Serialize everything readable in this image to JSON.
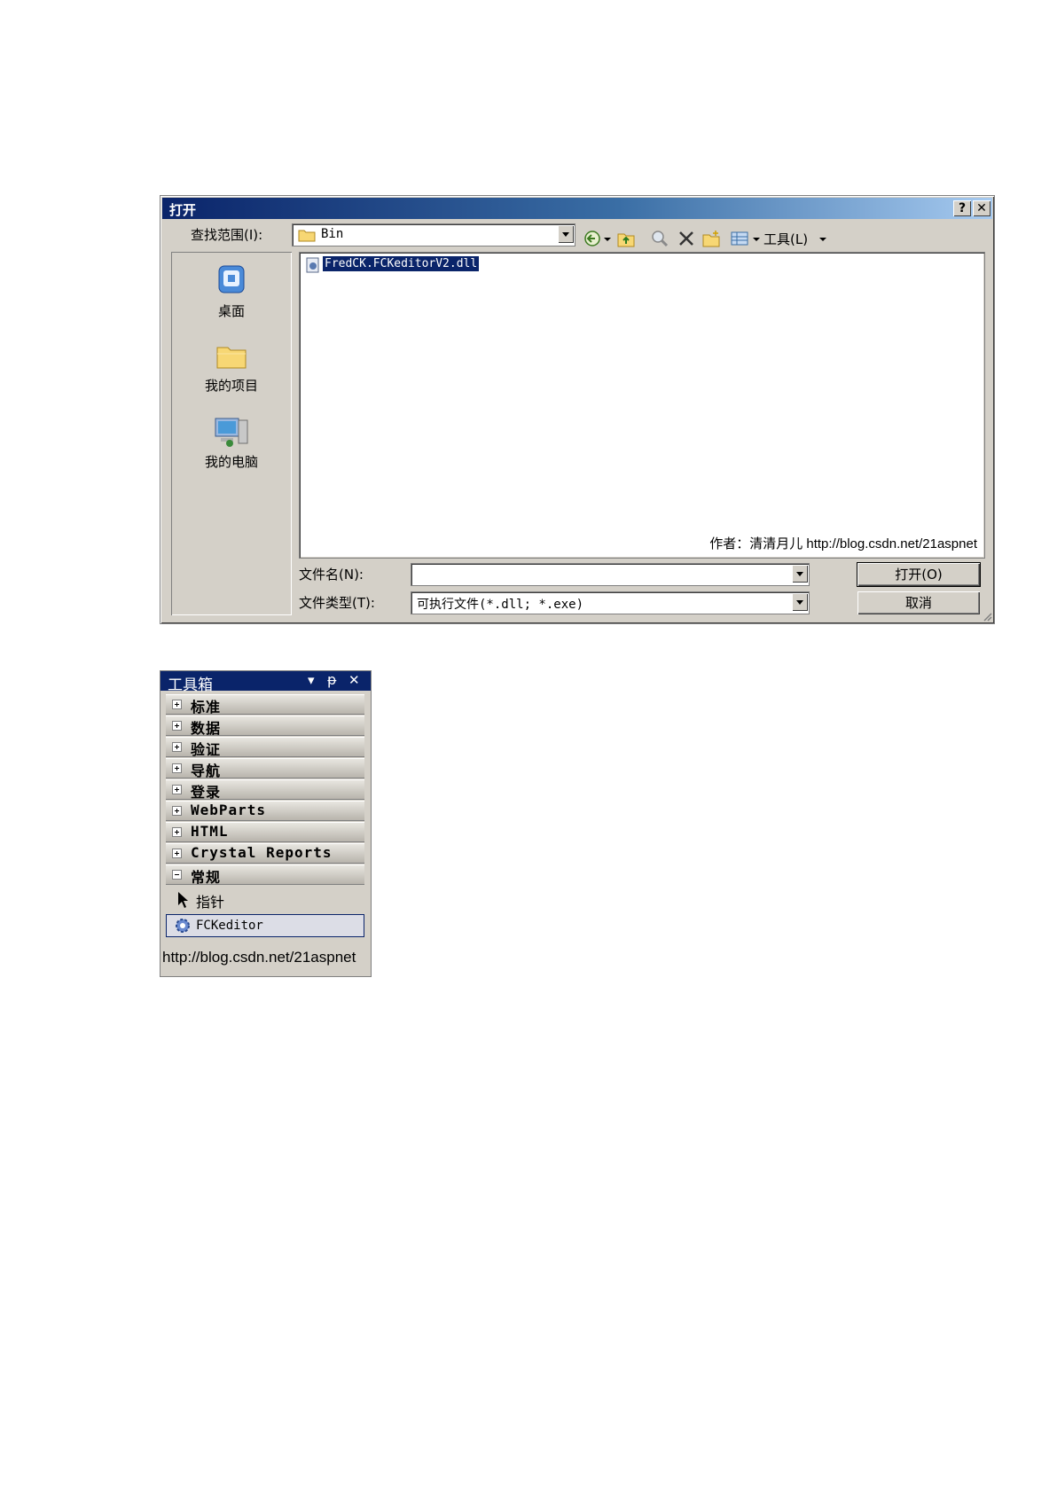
{
  "dialog": {
    "title": "打开",
    "help_btn": "?",
    "close_btn": "✕",
    "look_in_label": "查找范围(I):",
    "look_in_value": "Bin",
    "tools_label": "工具(L)",
    "places": [
      {
        "label": "桌面",
        "icon": "desktop-icon"
      },
      {
        "label": "我的项目",
        "icon": "folder-icon"
      },
      {
        "label": "我的电脑",
        "icon": "computer-icon"
      }
    ],
    "files": [
      {
        "name": "FredCK.FCKeditorV2.dll",
        "selected": true
      }
    ],
    "watermark": "作者：清清月儿 http://blog.csdn.net/21aspnet",
    "filename_label": "文件名(N):",
    "filename_value": "",
    "filetype_label": "文件类型(T):",
    "filetype_value": "可执行文件(*.dll; *.exe)",
    "open_button": "打开(O)",
    "cancel_button": "取消"
  },
  "toolbox": {
    "title": "工具箱",
    "controls": {
      "dropdown": "▾",
      "pin": "ᵽ",
      "close": "✕"
    },
    "categories": [
      {
        "label": "标准",
        "expanded": false
      },
      {
        "label": "数据",
        "expanded": false
      },
      {
        "label": "验证",
        "expanded": false
      },
      {
        "label": "导航",
        "expanded": false
      },
      {
        "label": "登录",
        "expanded": false
      },
      {
        "label": "WebParts",
        "expanded": false
      },
      {
        "label": "HTML",
        "expanded": false
      },
      {
        "label": "Crystal Reports",
        "expanded": false
      },
      {
        "label": "常规",
        "expanded": true
      }
    ],
    "items": [
      {
        "label": "指针",
        "icon": "pointer-icon"
      },
      {
        "label": "FCKeditor",
        "icon": "gear-icon",
        "selected": true
      }
    ],
    "url": "http://blog.csdn.net/21aspnet"
  },
  "colors": {
    "title_start": "#0a246a",
    "title_end": "#a6caf0",
    "selection": "#0a246a",
    "face": "#d4d0c8"
  }
}
